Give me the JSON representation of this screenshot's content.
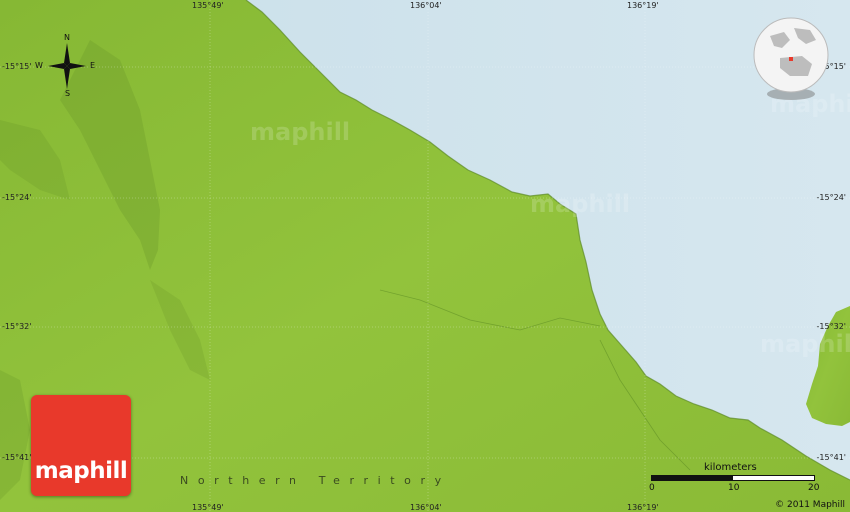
{
  "map": {
    "region_name": "Northern Territory",
    "colors": {
      "sea": "#cfe3ee",
      "land": "#8fbf3a",
      "land_dark": "#6e9c2a",
      "logo": "#e8392b"
    }
  },
  "coordinates": {
    "latitudes": [
      "-15°15'",
      "-15°24'",
      "-15°32'",
      "-15°41'"
    ],
    "latitudes_right": [
      "-15°15'",
      "-15°24'",
      "-15°32'",
      "-15°41'"
    ],
    "longitudes_top": [
      "135°49'",
      "136°04'",
      "136°19'"
    ],
    "longitudes_bottom": [
      "135°49'",
      "136°04'",
      "136°19'"
    ]
  },
  "compass": {
    "north": "N",
    "south": "S",
    "east": "E",
    "west": "W"
  },
  "scale": {
    "title": "kilometers",
    "ticks": [
      "0",
      "10",
      "20"
    ]
  },
  "brand": {
    "logo_text": "maphill",
    "watermark": "maphill"
  },
  "copyright": "© 2011 Maphill"
}
